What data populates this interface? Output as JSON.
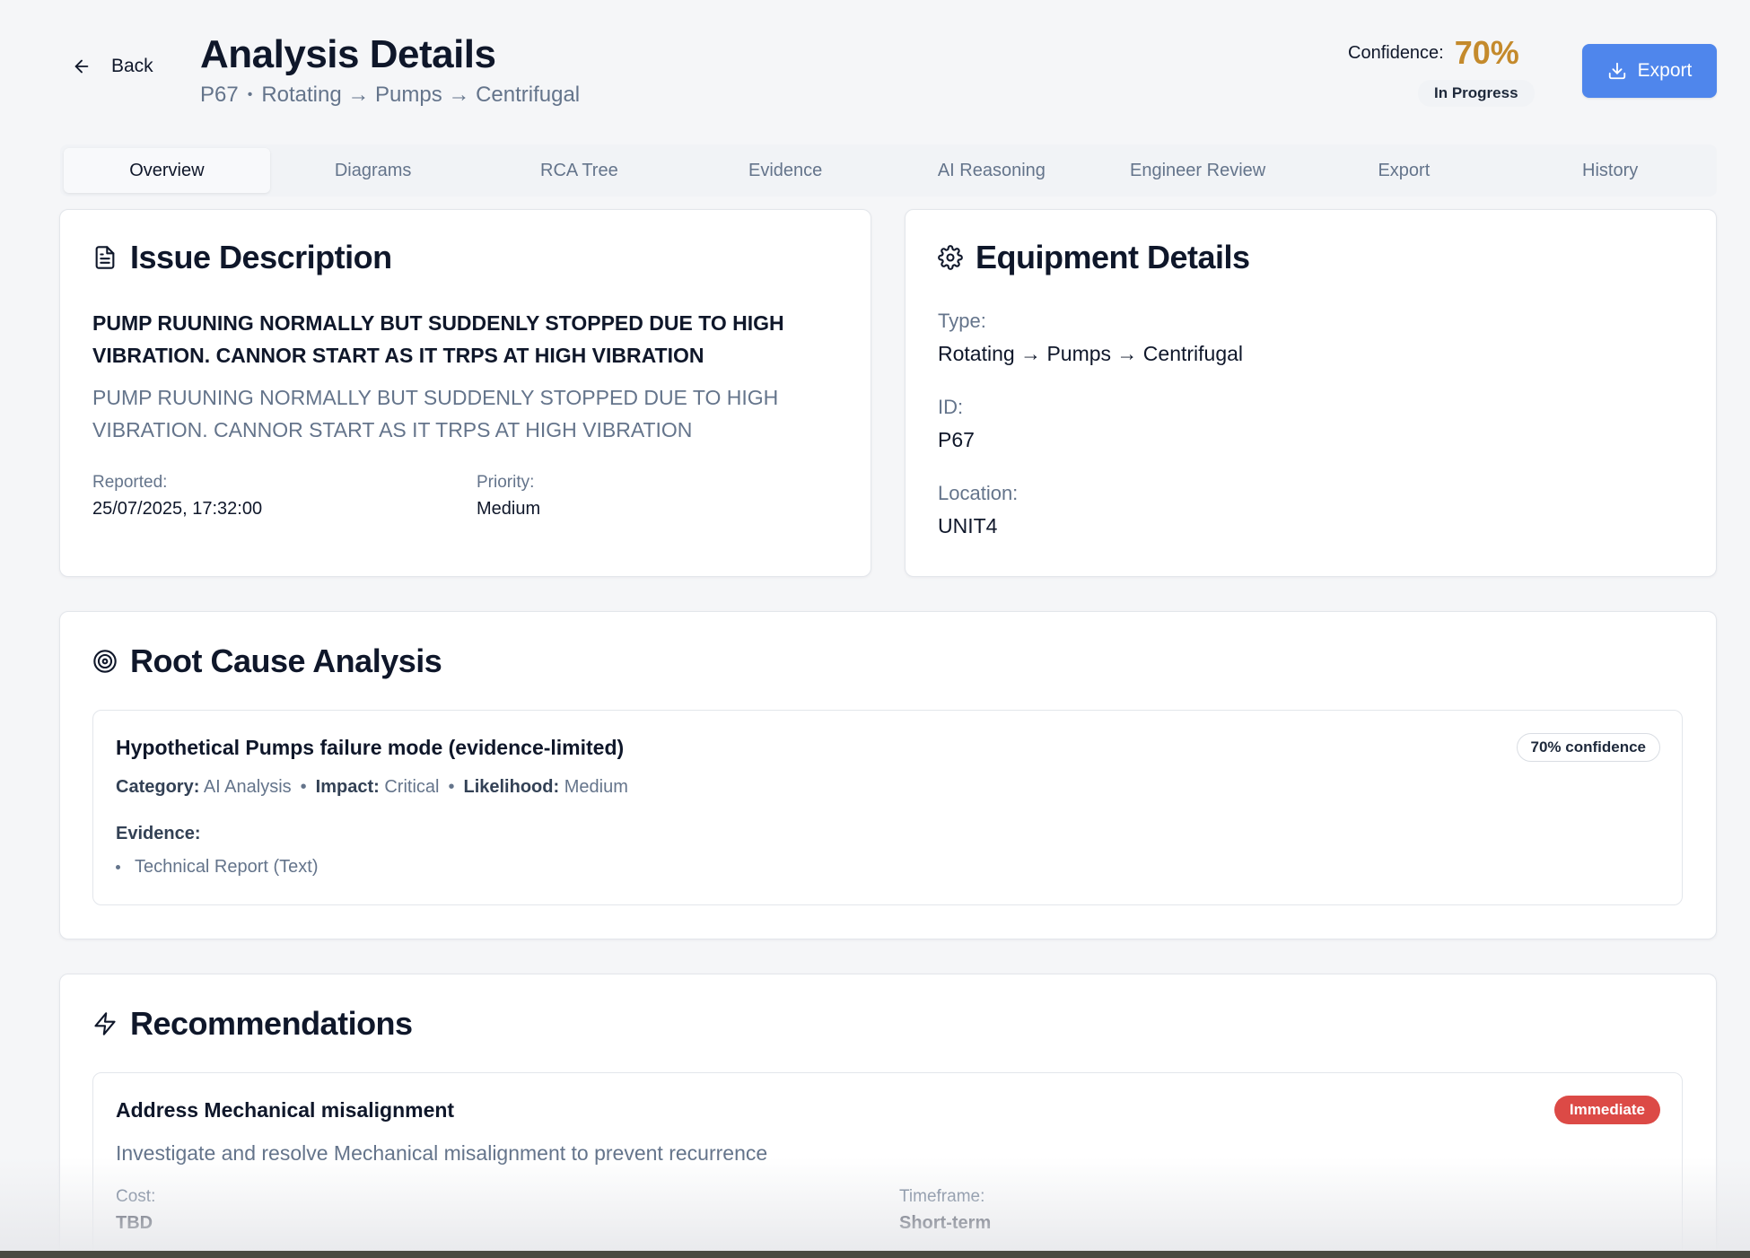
{
  "header": {
    "back_label": "Back",
    "title": "Analysis Details",
    "equipment_id": "P67",
    "equipment_path": "Rotating → Pumps → Centrifugal",
    "confidence_label": "Confidence:",
    "confidence_value": "70%",
    "status": "In Progress",
    "export_label": "Export"
  },
  "tabs": [
    "Overview",
    "Diagrams",
    "RCA Tree",
    "Evidence",
    "AI Reasoning",
    "Engineer Review",
    "Export",
    "History"
  ],
  "active_tab": "Overview",
  "issue": {
    "title": "Issue Description",
    "headline": "PUMP RUUNING NORMALLY BUT SUDDENLY STOPPED DUE TO HIGH VIBRATION. CANNOR START AS IT TRPS AT HIGH VIBRATION",
    "description": "PUMP RUUNING NORMALLY BUT SUDDENLY STOPPED DUE TO HIGH VIBRATION. CANNOR START AS IT TRPS AT HIGH VIBRATION",
    "reported_label": "Reported:",
    "reported_value": "25/07/2025, 17:32:00",
    "priority_label": "Priority:",
    "priority_value": "Medium"
  },
  "equipment": {
    "title": "Equipment Details",
    "type_label": "Type:",
    "type_value": "Rotating → Pumps → Centrifugal",
    "id_label": "ID:",
    "id_value": "P67",
    "location_label": "Location:",
    "location_value": "UNIT4"
  },
  "rca": {
    "title": "Root Cause Analysis",
    "hypothesis": {
      "title": "Hypothetical Pumps failure mode (evidence-limited)",
      "confidence_badge": "70% confidence",
      "category_label": "Category:",
      "category_value": "AI Analysis",
      "impact_label": "Impact:",
      "impact_value": "Critical",
      "likelihood_label": "Likelihood:",
      "likelihood_value": "Medium",
      "evidence_label": "Evidence:",
      "evidence_items": [
        "Technical Report (Text)"
      ]
    }
  },
  "recommendations": {
    "title": "Recommendations",
    "items": [
      {
        "title": "Address Mechanical misalignment",
        "badge": "Immediate",
        "description": "Investigate and resolve Mechanical misalignment to prevent recurrence",
        "cost_label": "Cost:",
        "cost_value": "TBD",
        "timeframe_label": "Timeframe:",
        "timeframe_value": "Short-term"
      }
    ]
  },
  "colors": {
    "accent": "#4f86ec",
    "confidence": "#c48a2c",
    "immediate": "#dc4a46",
    "background": "#f5f6f8"
  },
  "icons": {
    "back": "arrow-left-icon",
    "export": "download-icon",
    "issue": "document-icon",
    "equipment": "gear-icon",
    "rca": "target-icon",
    "recommendations": "lightning-icon"
  }
}
